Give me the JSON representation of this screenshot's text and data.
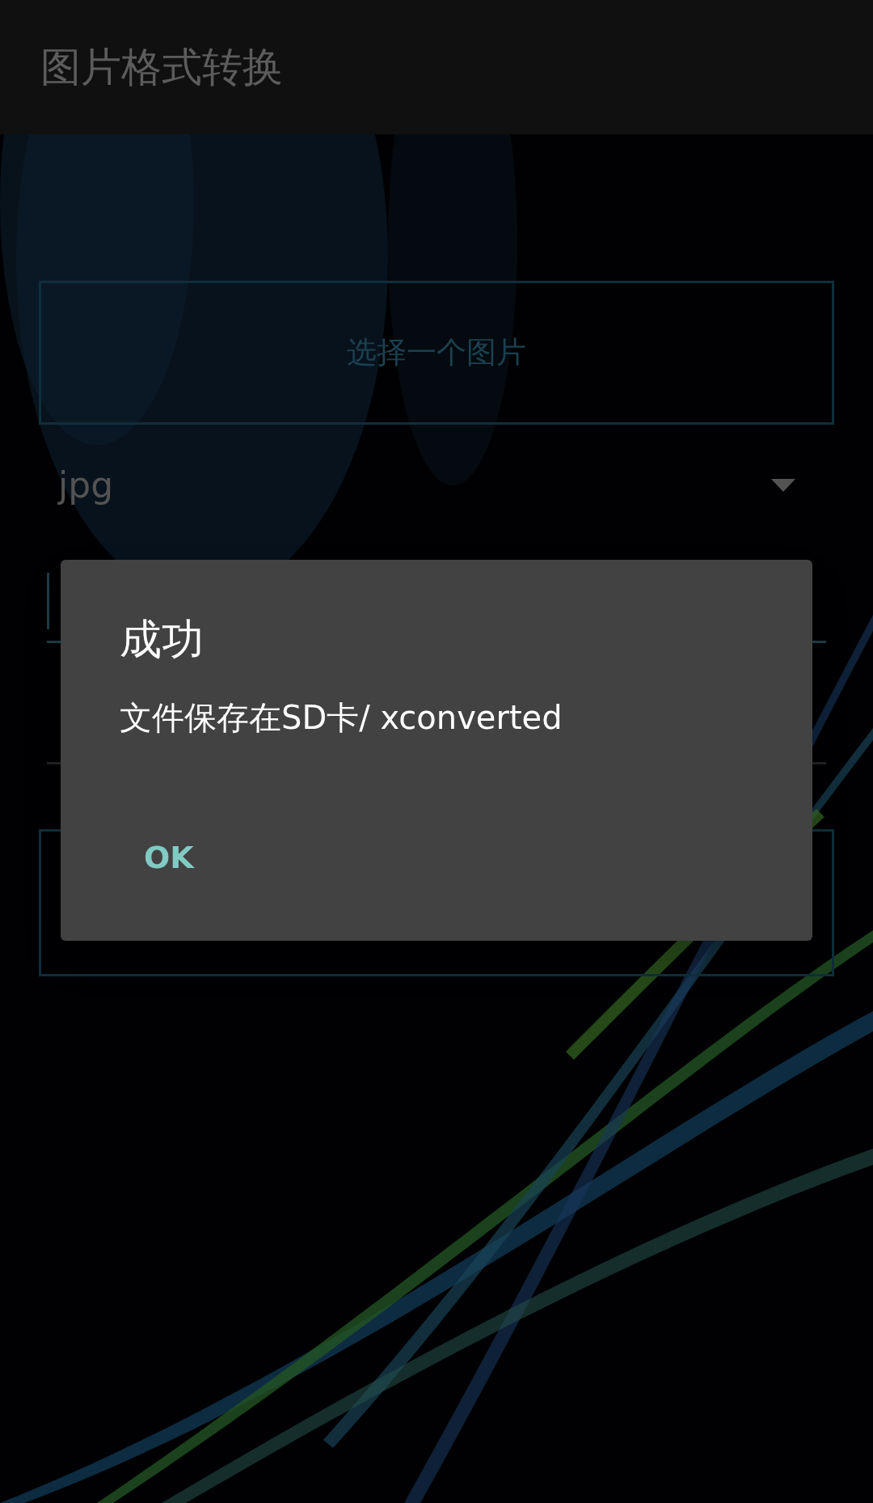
{
  "app_bar": {
    "title": "图片格式转换"
  },
  "pick_button": {
    "label": "选择一个图片"
  },
  "format_spinner": {
    "value": "jpg"
  },
  "fields": [
    {
      "focused": true
    },
    {
      "focused": false
    }
  ],
  "dialog": {
    "title": "成功",
    "message": "文件保存在SD卡/ xconverted",
    "buttons": [
      "OK"
    ]
  }
}
